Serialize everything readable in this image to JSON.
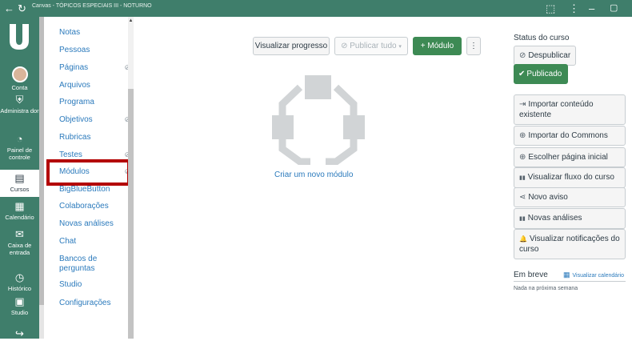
{
  "window": {
    "title": "Canvas - TÓPICOS ESPECIAIS III - NOTURNO",
    "back_icon": "←",
    "reload_icon": "↻",
    "ext_icon": "⬚",
    "menu_icon": "⋮",
    "minimize_icon": "–",
    "restore_icon": "▢"
  },
  "global_nav": {
    "items": [
      {
        "label": "Conta",
        "icon": "avatar"
      },
      {
        "label": "Administra dor",
        "icon": "⛨"
      },
      {
        "label": "Painel de controle",
        "icon": "◔"
      },
      {
        "label": "Cursos",
        "icon": "▤"
      },
      {
        "label": "Calendário",
        "icon": "▦"
      },
      {
        "label": "Caixa de entrada",
        "icon": "✉"
      },
      {
        "label": "Histórico",
        "icon": "◷"
      },
      {
        "label": "Studio",
        "icon": "▣"
      },
      {
        "label": "",
        "icon": "↪"
      }
    ]
  },
  "course_nav": {
    "items": [
      {
        "label": "Notas",
        "hidden": false
      },
      {
        "label": "Pessoas",
        "hidden": false
      },
      {
        "label": "Páginas",
        "hidden": true
      },
      {
        "label": "Arquivos",
        "hidden": false
      },
      {
        "label": "Programa",
        "hidden": false
      },
      {
        "label": "Objetivos",
        "hidden": true
      },
      {
        "label": "Rubricas",
        "hidden": false
      },
      {
        "label": "Testes",
        "hidden": true
      },
      {
        "label": "Módulos",
        "hidden": true
      },
      {
        "label": "BigBlueButton",
        "hidden": false
      },
      {
        "label": "Colaborações",
        "hidden": false
      },
      {
        "label": "Novas análises",
        "hidden": false
      },
      {
        "label": "Chat",
        "hidden": false
      },
      {
        "label": "Bancos de perguntas",
        "hidden": false
      },
      {
        "label": "Studio",
        "hidden": false
      },
      {
        "label": "Configurações",
        "hidden": false
      }
    ],
    "hidden_icon": "⊘",
    "selected_item": "Módulos"
  },
  "toolbar": {
    "progress_label": "Visualizar progresso",
    "publish_all_label": "Publicar tudo",
    "publish_icon": "⊘",
    "caret": "▾",
    "add_module_label": "+ Módulo",
    "more_icon": "⋮"
  },
  "empty_state": {
    "create_link": "Criar um novo módulo"
  },
  "sidebar": {
    "status_title": "Status do curso",
    "unpublish_label": "Despublicar",
    "unpublish_icon": "⊘",
    "published_label": "Publicado",
    "published_icon": "✔",
    "actions": [
      {
        "label": "Importar conteúdo existente",
        "icon": "⇥"
      },
      {
        "label": "Importar do Commons",
        "icon": "⊕"
      },
      {
        "label": "Escolher página inicial",
        "icon": "⊕"
      },
      {
        "label": "Visualizar fluxo do curso",
        "icon": "▮▮"
      },
      {
        "label": "Novo aviso",
        "icon": "⋖"
      },
      {
        "label": "Novas análises",
        "icon": "▮▮"
      },
      {
        "label": "Visualizar notificações do curso",
        "icon": "🔔"
      }
    ],
    "coming_up_title": "Em breve",
    "calendar_icon": "▦",
    "calendar_link": "Visualizar calendário",
    "nothing_text": "Nada na próxima semana"
  },
  "colors": {
    "brand": "#3f7e6b",
    "link": "#2b7abc",
    "success": "#3d8a54",
    "highlight": "#b30000"
  }
}
